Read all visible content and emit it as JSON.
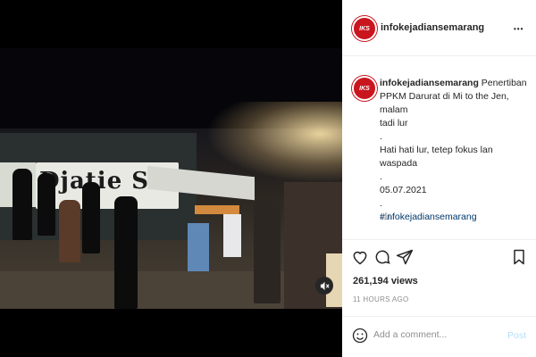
{
  "post": {
    "username": "infokejadiansemarang",
    "avatar_text": "IKS",
    "more_symbol": "•••",
    "caption_lines": [
      "Penertiban",
      "PPKM Darurat di Mi to the Jen, malam",
      "tadi lur",
      ".",
      "Hati hati lur, tetep fokus lan waspada",
      ".",
      "05.07.2021",
      "."
    ],
    "hashtag": "#infokejadiansemarang",
    "comment_time": "11h",
    "views": "261,194 views",
    "posted_ago": "11 HOURS AGO"
  },
  "video": {
    "sign_text": "Djatie Steak",
    "mute_icon": "speaker-muted-icon"
  },
  "comment": {
    "placeholder": "Add a comment...",
    "post_label": "Post"
  },
  "colors": {
    "avatar_red": "#c9151e",
    "hashtag_blue": "#00376b",
    "post_disabled": "#b2dffc",
    "muted_text": "#8e8e8e"
  }
}
